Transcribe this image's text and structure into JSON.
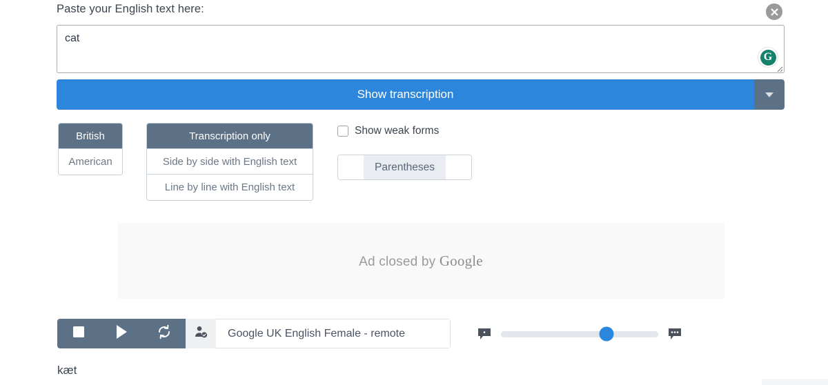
{
  "header": {
    "paste_label": "Paste your English text here:",
    "close_icon": "close-circle-icon"
  },
  "input": {
    "value": "cat",
    "placeholder": "Paste your English text here",
    "grammarly_icon": "grammarly-logo-icon",
    "grammarly_letter": "G",
    "resize_handle": "resize-grip-icon"
  },
  "primary_action": {
    "label": "Show transcription",
    "caret_icon": "chevron-down-icon",
    "color": "#2b86dc",
    "caret_color": "#5d7186"
  },
  "accent_group": {
    "options": [
      {
        "label": "British",
        "active": true
      },
      {
        "label": "American",
        "active": false
      }
    ]
  },
  "layout_group": {
    "options": [
      {
        "label": "Transcription only",
        "active": true
      },
      {
        "label": "Side by side with English text",
        "active": false
      },
      {
        "label": "Line by line with English text",
        "active": false
      }
    ]
  },
  "weak_forms": {
    "label": "Show weak forms",
    "checked": false,
    "checkbox_icon": "checkbox-unchecked-icon"
  },
  "parentheses_group": {
    "left_label": "",
    "label": "Parentheses",
    "right_label": "",
    "selected": "Parentheses",
    "highlight_color": "#e9edf1"
  },
  "ad": {
    "text_prefix": "Ad closed by ",
    "brand": "Google"
  },
  "player": {
    "stop_icon": "stop-square-icon",
    "play_icon": "play-triangle-icon",
    "loop_icon": "loop-refresh-icon",
    "voice_icon": "person-check-icon",
    "voice_label": "Google UK English Female - remote",
    "toolbar_color": "#5d7186"
  },
  "rate": {
    "slow_icon": "speech-bubble-one-dot-icon",
    "fast_icon": "speech-bubble-three-dots-icon",
    "value_percent": 67,
    "thumb_color": "#2b86dc"
  },
  "output": {
    "transcription": "kæt"
  }
}
